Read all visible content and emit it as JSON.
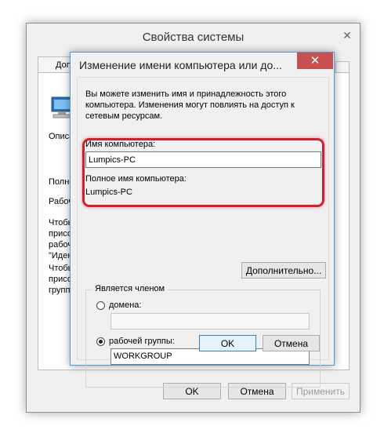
{
  "outer_window": {
    "title": "Свойства системы",
    "close_glyph": "✕",
    "tab_label": "Дополнительно",
    "left_fragments": [
      "Описа",
      "Полно",
      "Рабоч",
      "Чтобы",
      "присо",
      "рабоч",
      "\"Иден",
      "Чтобы",
      "присо",
      "групп"
    ],
    "ok_label": "OK",
    "cancel_label": "Отмена",
    "apply_label": "Применить"
  },
  "dialog": {
    "title": "Изменение имени компьютера или до...",
    "close_glyph": "✕",
    "description": "Вы можете изменить имя и принадлежность этого компьютера. Изменения могут повлиять на доступ к сетевым ресурсам.",
    "computer_name_label": "Имя компьютера:",
    "computer_name_value": "Lumpics-PC",
    "full_name_label": "Полное имя компьютера:",
    "full_name_value": "Lumpics-PC",
    "more_button": "Дополнительно...",
    "member_of_legend": "Является членом",
    "domain_label": "домена:",
    "domain_value": "",
    "domain_checked": false,
    "workgroup_label": "рабочей группы:",
    "workgroup_value": "WORKGROUP",
    "workgroup_checked": true,
    "ok_label": "OK",
    "cancel_label": "Отмена"
  },
  "colors": {
    "highlight": "#d0202a",
    "dialog_border": "#4c9bd6",
    "close_button": "#c75050"
  }
}
